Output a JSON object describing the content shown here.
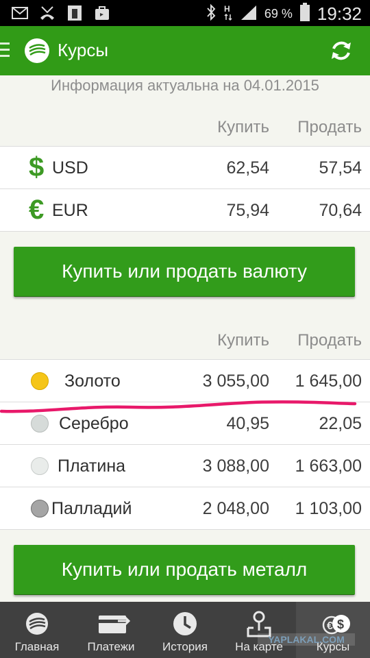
{
  "status_bar": {
    "battery": "69 %",
    "time": "19:32"
  },
  "app_bar": {
    "title": "Курсы"
  },
  "info": {
    "text": "Информация актуальна на 04.01.2015"
  },
  "currency_section": {
    "header": {
      "buy": "Купить",
      "sell": "Продать"
    },
    "rows": [
      {
        "symbol": "$",
        "code": "USD",
        "buy": "62,54",
        "sell": "57,54"
      },
      {
        "symbol": "€",
        "code": "EUR",
        "buy": "75,94",
        "sell": "70,64"
      }
    ],
    "button_label": "Купить или продать валюту"
  },
  "metal_section": {
    "header": {
      "buy": "Купить",
      "sell": "Продать"
    },
    "rows": [
      {
        "name": "Золото",
        "buy": "3 055,00",
        "sell": "1 645,00",
        "dot_color": "#f5c518"
      },
      {
        "name": "Серебро",
        "buy": "40,95",
        "sell": "22,05",
        "dot_color": "#d6dbd9"
      },
      {
        "name": "Платина",
        "buy": "3 088,00",
        "sell": "1 663,00",
        "dot_color": "#e9ecea"
      },
      {
        "name": "Палладий",
        "buy": "2 048,00",
        "sell": "1 103,00",
        "dot_color": "#a5a5a5"
      }
    ],
    "button_label": "Купить или продать металл"
  },
  "bottom_nav": {
    "items": [
      {
        "label": "Главная",
        "icon": "sberbank-logo-icon"
      },
      {
        "label": "Платежи",
        "icon": "payment-card-icon"
      },
      {
        "label": "История",
        "icon": "clock-icon"
      },
      {
        "label": "На карте",
        "icon": "map-pin-icon"
      },
      {
        "label": "Курсы",
        "icon": "exchange-rates-icon"
      }
    ]
  },
  "watermark": {
    "text": "YAPLAKAL.COM"
  },
  "colors": {
    "brand_green": "#319b17",
    "annotation_pink": "#e8196a"
  }
}
